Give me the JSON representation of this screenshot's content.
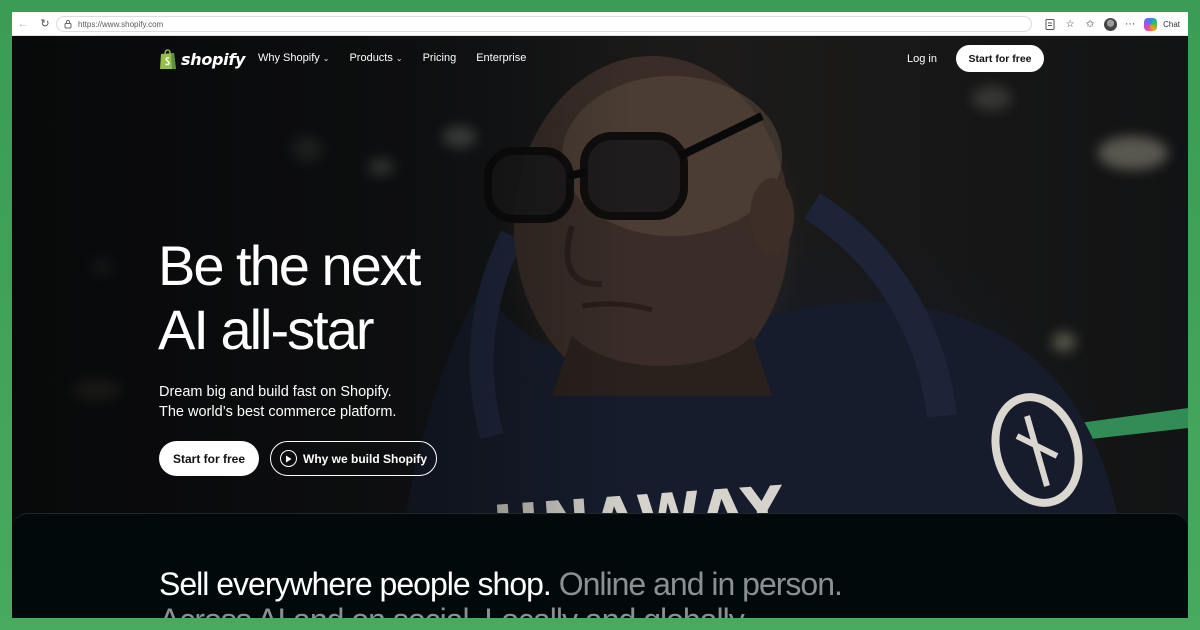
{
  "browser": {
    "url": "https://www.shopify.com",
    "chat_label": "Chat",
    "icons": [
      "back-arrow-icon",
      "refresh-icon",
      "lock-icon",
      "reader-mode-icon",
      "star-icon",
      "favorites-icon",
      "profile-avatar",
      "more-icon",
      "copilot-icon"
    ]
  },
  "nav": {
    "logo_text": "shopify",
    "links": [
      {
        "label": "Why Shopify",
        "has_menu": true
      },
      {
        "label": "Products",
        "has_menu": true
      },
      {
        "label": "Pricing",
        "has_menu": false
      },
      {
        "label": "Enterprise",
        "has_menu": false
      }
    ],
    "login": "Log in",
    "cta": "Start for free"
  },
  "hero": {
    "headline_line1": "Be the next",
    "headline_line2": "AI all-star",
    "sub_line1": "Dream big and build fast on Shopify.",
    "sub_line2": "The world’s best commerce platform.",
    "primary_cta": "Start for free",
    "secondary_cta": "Why we build Shopify"
  },
  "section": {
    "text_white": "Sell everywhere people shop.",
    "text_gray": "Online and in person.",
    "text_line2": "Across AI and on social. Locally and globally."
  },
  "colors": {
    "frame_green": "#47aa5e",
    "hero_bg": "#0d0f10",
    "panel_bg": "#02090a",
    "muted_text": "#8a9192",
    "shopify_green": "#95bf47"
  }
}
